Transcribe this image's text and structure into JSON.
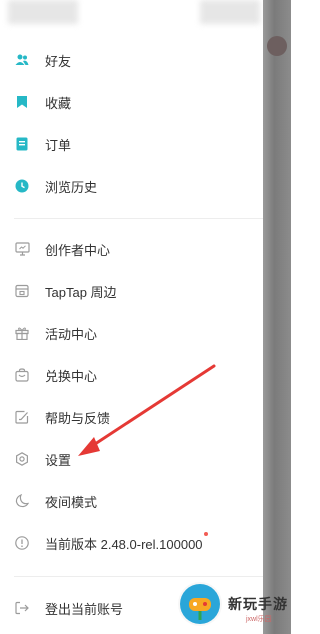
{
  "colors": {
    "accent": "#26b8c6",
    "icon_gray": "#9b9b9b",
    "text": "#333333",
    "badge_red": "#f25c54",
    "arrow_red": "#e53935"
  },
  "menu_primary": [
    {
      "label": "好友",
      "icon": "friends-icon"
    },
    {
      "label": "收藏",
      "icon": "bookmark-icon"
    },
    {
      "label": "订单",
      "icon": "order-icon"
    },
    {
      "label": "浏览历史",
      "icon": "clock-icon"
    }
  ],
  "menu_secondary": [
    {
      "label": "创作者中心",
      "icon": "monitor-icon"
    },
    {
      "label": "TapTap 周边",
      "icon": "store-icon"
    },
    {
      "label": "活动中心",
      "icon": "gift-icon"
    },
    {
      "label": "兑换中心",
      "icon": "bag-icon"
    },
    {
      "label": "帮助与反馈",
      "icon": "feedback-icon"
    },
    {
      "label": "设置",
      "icon": "settings-icon"
    },
    {
      "label": "夜间模式",
      "icon": "moon-icon"
    },
    {
      "label": "当前版本 2.48.0-rel.100000",
      "icon": "info-icon"
    }
  ],
  "logout": {
    "label": "登出当前账号",
    "icon": "logout-icon"
  },
  "watermark": {
    "text": "新玩手游",
    "sub": "jxwl乐园"
  }
}
